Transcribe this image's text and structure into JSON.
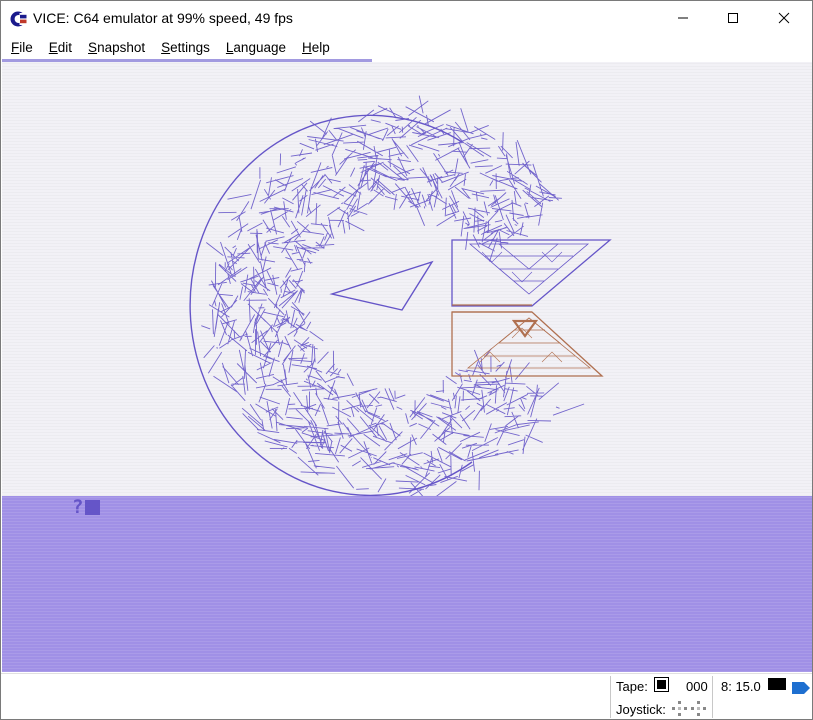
{
  "window": {
    "title": "VICE: C64 emulator at 99% speed, 49 fps"
  },
  "menu": {
    "items": [
      {
        "underline": "F",
        "rest": "ile"
      },
      {
        "underline": "E",
        "rest": "dit"
      },
      {
        "underline": "S",
        "rest": "napshot"
      },
      {
        "underline": "S",
        "rest": "ettings"
      },
      {
        "underline": "L",
        "rest": "anguage"
      },
      {
        "underline": "H",
        "rest": "elp"
      }
    ]
  },
  "screen": {
    "prompt": "?",
    "colors": {
      "border_blue": "#6555c8",
      "light_blue": "#a090e6",
      "brown": "#b07050",
      "background": "#f2f1f6"
    }
  },
  "status": {
    "tape_label": "Tape:",
    "tape_counter": "000",
    "drive_label": "8: 15.0",
    "joystick_label": "Joystick:"
  },
  "icons": {
    "app": "commodore-logo-icon",
    "minimize": "minimize-icon",
    "maximize": "maximize-icon",
    "close": "close-icon",
    "tape_stop": "stop-icon",
    "joystick": "joystick-dpad-icon",
    "speaker": "speaker-icon"
  }
}
